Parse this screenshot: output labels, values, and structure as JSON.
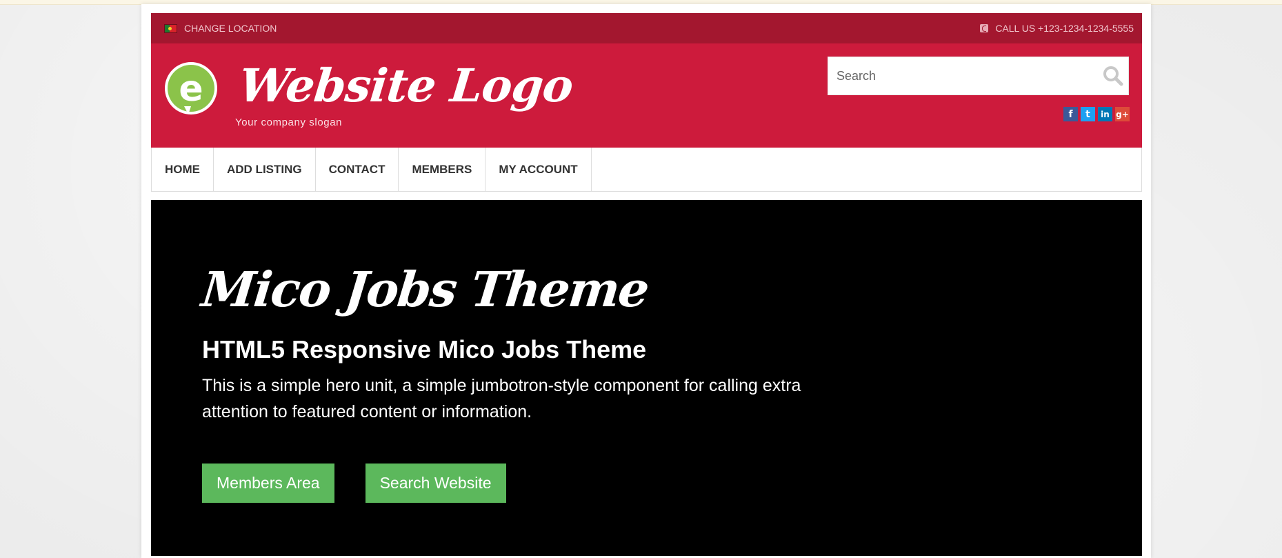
{
  "topbar": {
    "change_location": "CHANGE LOCATION",
    "call_us": "CALL US +123-1234-1234-5555",
    "flag_icon": "portugal-flag-icon",
    "phone_icon": "phone-icon"
  },
  "header": {
    "logo_letter": "e",
    "logo_text": "Website Logo",
    "slogan": "Your company slogan",
    "search_placeholder": "Search",
    "social": [
      "f",
      "t",
      "in",
      "g+"
    ]
  },
  "nav": {
    "items": [
      "HOME",
      "ADD LISTING",
      "CONTACT",
      "MEMBERS",
      "MY ACCOUNT"
    ]
  },
  "hero": {
    "title": "Mico Jobs Theme",
    "subtitle": "HTML5 Responsive Mico Jobs Theme",
    "text": "This is a simple hero unit, a simple jumbotron-style component for calling extra attention to featured content or information.",
    "button_members": "Members Area",
    "button_search": "Search Website"
  },
  "colors": {
    "topbar": "#a3172f",
    "header": "#cd1b3c",
    "hero_bg": "#000000",
    "button": "#5cb85c",
    "logo_green": "#8bc34a"
  }
}
